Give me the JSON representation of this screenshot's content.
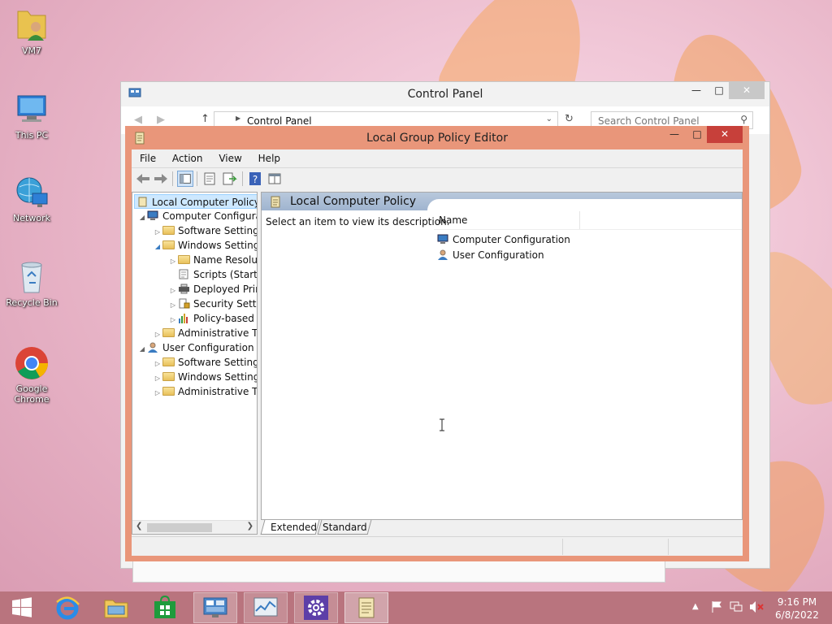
{
  "desktop": {
    "icons": [
      {
        "label": "VM7"
      },
      {
        "label": "This PC"
      },
      {
        "label": "Network"
      },
      {
        "label": "Recycle Bin"
      },
      {
        "label": "Google Chrome"
      }
    ]
  },
  "control_panel": {
    "title": "Control Panel",
    "address": "Control Panel",
    "search_placeholder": "Search Control Panel"
  },
  "gpedit": {
    "title": "Local Group Policy Editor",
    "menu": [
      "File",
      "Action",
      "View",
      "Help"
    ],
    "tree": {
      "root": "Local Computer Policy",
      "computer": "Computer Configura",
      "computer_software": "Software Settings",
      "computer_windows": "Windows Setting",
      "name_resolution": "Name Resolu",
      "scripts": "Scripts (Startu",
      "deployed_printers": "Deployed Prir",
      "security": "Security Settir",
      "policy_qos": "Policy-based",
      "computer_admin": "Administrative Te",
      "user": "User Configuration",
      "user_software": "Software Settings",
      "user_windows": "Windows Setting",
      "user_admin": "Administrative Te"
    },
    "panel": {
      "heading": "Local Computer Policy",
      "description": "Select an item to view its description.",
      "column_name": "Name",
      "items": [
        "Computer Configuration",
        "User Configuration"
      ]
    },
    "tabs": [
      "Extended",
      "Standard"
    ]
  },
  "taskbar": {
    "time": "9:16 PM",
    "date": "6/8/2022"
  },
  "colors": {
    "gpedit_frame": "#e9967a",
    "close_red": "#c7403a",
    "taskbar": "#b9747e",
    "panel_header": "#9fb4cf"
  }
}
